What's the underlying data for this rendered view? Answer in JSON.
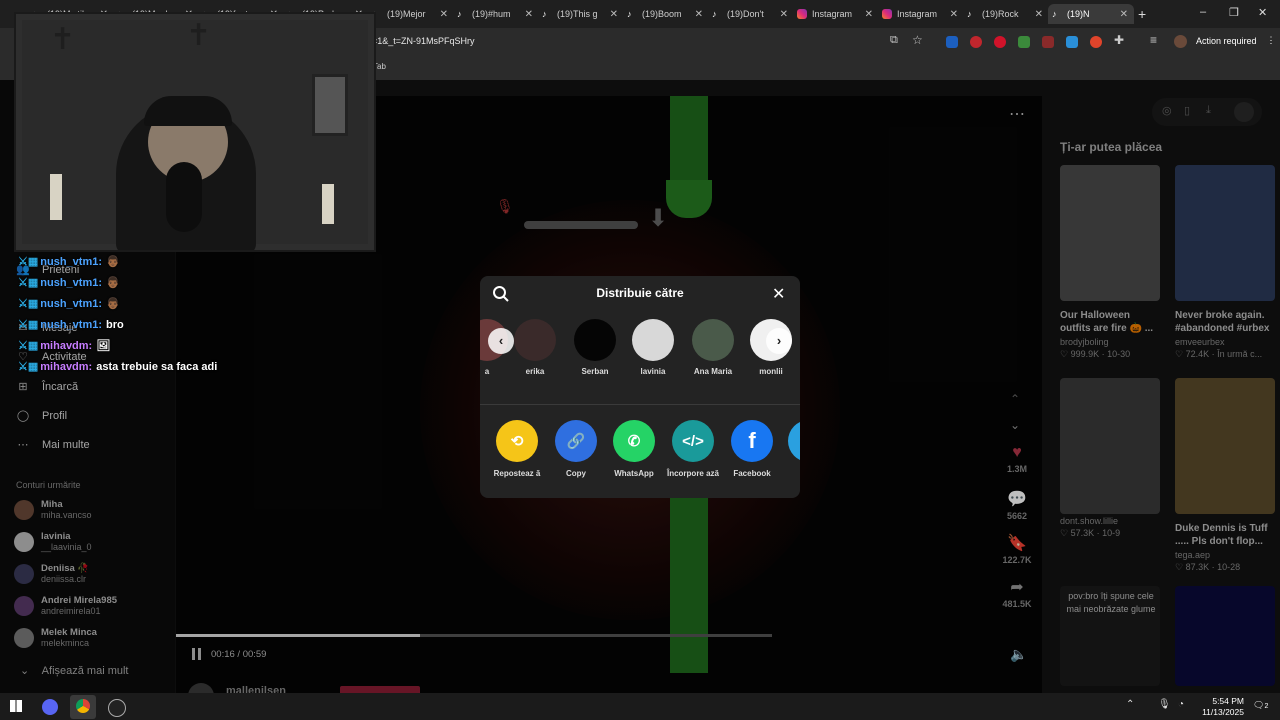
{
  "browser": {
    "tabs": [
      {
        "label": "(19)My tik",
        "icon": "tiktok"
      },
      {
        "label": "(19)My dr",
        "icon": "tiktok"
      },
      {
        "label": "(19)fenta",
        "icon": "tiktok"
      },
      {
        "label": "(19)Purb",
        "icon": "tiktok"
      },
      {
        "label": "(19)Mejor",
        "icon": "tiktok"
      },
      {
        "label": "(19)#hum",
        "icon": "tiktok"
      },
      {
        "label": "(19)This g",
        "icon": "tiktok"
      },
      {
        "label": "(19)Boom",
        "icon": "tiktok"
      },
      {
        "label": "(19)Don't",
        "icon": "tiktok"
      },
      {
        "label": "Instagram",
        "icon": "instagram"
      },
      {
        "label": "Instagram",
        "icon": "instagram"
      },
      {
        "label": "(19)Rock",
        "icon": "tiktok"
      },
      {
        "label": "(19)N",
        "icon": "tiktok",
        "active": true
      }
    ],
    "new_tab": "+",
    "url": "=1&_t=ZN-91MsPFqSHry",
    "bookmark_hint": "Tab",
    "action_required": "Action required",
    "window_controls": [
      "–",
      "❐",
      "✕"
    ]
  },
  "sidebar": {
    "items": [
      {
        "icon": "friends-icon",
        "label": "Prieteni"
      },
      {
        "icon": "message-icon",
        "label": "Mesaje"
      },
      {
        "icon": "activity-icon",
        "label": "Activitate"
      },
      {
        "icon": "upload-icon",
        "label": "Încarcă"
      },
      {
        "icon": "profile-icon",
        "label": "Profil"
      },
      {
        "icon": "more-icon",
        "label": "Mai multe"
      }
    ],
    "following_header": "Conturi urmărite",
    "following": [
      {
        "name": "Miha",
        "handle": "miha.vancso",
        "color": "#6b4a3a"
      },
      {
        "name": "lavinia",
        "handle": "__laavinia_0",
        "color": "#bdbdbd"
      },
      {
        "name": "Deniisa 🥀",
        "handle": "deniissa.clr",
        "color": "#3a3a5a"
      },
      {
        "name": "Andrei Mirela985",
        "handle": "andreimirela01",
        "color": "#5a3a6a"
      },
      {
        "name": "Melek Minca",
        "handle": "melekminca",
        "color": "#7a7a7a"
      }
    ],
    "show_more": "Afișează mai mult"
  },
  "video": {
    "time": "00:16 / 00:59",
    "progress": 0.41,
    "author": "mallenilsen"
  },
  "actions": {
    "likes": "1.3M",
    "comments": "5662",
    "saves": "122.7K",
    "shares": "481.5K"
  },
  "recommendations": {
    "title": "Ți-ar putea plăcea",
    "cards": [
      {
        "caption": "Our Halloween outfits are fire 🎃 ...",
        "user": "brodyjboling",
        "views": "999.9K",
        "date": "10-30",
        "color": "#4a4a4a"
      },
      {
        "caption": "Never broke again. #abandoned #urbex",
        "user": "emveeurbex",
        "views": "72.4K",
        "date": "În urmă c...",
        "color": "#2b3a5a"
      },
      {
        "caption": "",
        "user": "dont.show.lillie",
        "views": "57.3K",
        "date": "10-9",
        "color": "#3a3a3a"
      },
      {
        "caption": "Duke Dennis is Tuff ..... Pls don't flop...",
        "user": "tega.aep",
        "views": "87.3K",
        "date": "10-28",
        "color": "#5a4a2a"
      },
      {
        "caption": "pov:bro îți spune cele mai neobrăzate glume",
        "user": "",
        "views": "",
        "date": "",
        "color": "#1a1a1a"
      },
      {
        "caption": "",
        "user": "",
        "views": "",
        "date": "",
        "color": "#0a0a3a"
      }
    ]
  },
  "share_modal": {
    "title": "Distribuie către",
    "contacts": [
      {
        "name": "a",
        "color": "#6a3a3a"
      },
      {
        "name": "erika",
        "color": "#3a2a2a"
      },
      {
        "name": "Serban",
        "color": "#050505"
      },
      {
        "name": "lavinia",
        "color": "#d8d8d8"
      },
      {
        "name": "Ana Maria",
        "color": "#4a5a4a"
      },
      {
        "name": "monlii",
        "color": "#f0f0f0"
      }
    ],
    "options": [
      {
        "label": "Reposteaz ă",
        "color": "#f5c518",
        "icon": "repost-icon"
      },
      {
        "label": "Copy",
        "color": "#2f6fe0",
        "icon": "link-icon"
      },
      {
        "label": "WhatsApp",
        "color": "#25d366",
        "icon": "whatsapp-icon"
      },
      {
        "label": "Încorpore ază",
        "color": "#1a9a9a",
        "icon": "embed-icon"
      },
      {
        "label": "Facebook",
        "color": "#1877f2",
        "icon": "facebook-icon"
      },
      {
        "label": "Te",
        "color": "#2aa0e0",
        "icon": "telegram-icon"
      }
    ]
  },
  "chat": [
    {
      "user": "nush_vtm1:",
      "msg": "👨🏾",
      "color": "#4ca3ff"
    },
    {
      "user": "nush_vtm1:",
      "msg": "👨🏾",
      "color": "#4ca3ff"
    },
    {
      "user": "nush_vtm1:",
      "msg": "👨🏾",
      "color": "#4ca3ff"
    },
    {
      "user": "nush_vtm1:",
      "msg": "bro",
      "color": "#4ca3ff"
    },
    {
      "user": "mihavdm:",
      "msg": "🖼",
      "color": "#c77dff"
    },
    {
      "user": "mihavdm:",
      "msg": "asta trebuie sa faca adi",
      "color": "#c77dff"
    }
  ],
  "taskbar": {
    "time": "5:54 PM",
    "date": "11/13/2025",
    "notifications": "2"
  }
}
